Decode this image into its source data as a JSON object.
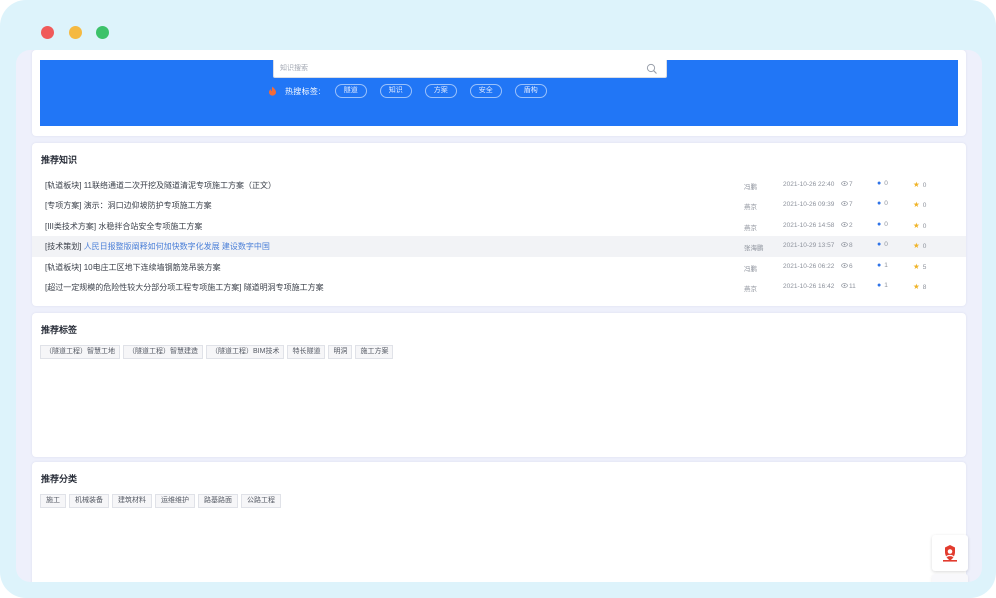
{
  "window": {
    "controls": [
      "close-dot",
      "minimize-dot",
      "maximize-dot"
    ],
    "colors": {
      "close": "#f05a5a",
      "minimize": "#f5b941",
      "maximize": "#3cc26a"
    }
  },
  "hero": {
    "background": "#2176f6",
    "search": {
      "placeholder": "知识搜索",
      "icon": "search-icon"
    },
    "hot": {
      "label": "热搜标签:",
      "icon": "fire-icon",
      "tags": [
        "隧道",
        "知识",
        "方案",
        "安全",
        "盾构"
      ]
    }
  },
  "knowledge": {
    "title": "推荐知识",
    "items": [
      {
        "category": "[轨道板块]",
        "title": "11联络通道二次开挖及隧道清泥专项施工方案（正文）",
        "author": "冯鹏",
        "date": "2021-10-26 22:40",
        "views": "7",
        "comments": "0",
        "stars": "0"
      },
      {
        "category": "[专项方案]",
        "title": "演示：洞口边仰坡防护专项施工方案",
        "author": "燕京",
        "date": "2021-10-26 09:39",
        "views": "7",
        "comments": "0",
        "stars": "0"
      },
      {
        "category": "[III类技术方案]",
        "title": "水稳拌合站安全专项施工方案",
        "author": "燕京",
        "date": "2021-10-26 14:58",
        "views": "2",
        "comments": "0",
        "stars": "0"
      },
      {
        "category": "[技术策划]",
        "title": "人民日报整版阐释如何加快数字化发展 建设数字中国",
        "author": "张海鹏",
        "date": "2021-10-29 13:57",
        "views": "8",
        "comments": "0",
        "stars": "0",
        "highlight": true
      },
      {
        "category": "[轨道板块]",
        "title": "10电庄工区地下连续墙钢筋笼吊装方案",
        "author": "冯鹏",
        "date": "2021-10-26 06:22",
        "views": "6",
        "comments": "1",
        "stars": "5"
      },
      {
        "category": "[超过一定规模的危险性较大分部分项工程专项施工方案]",
        "title": "隧道明洞专项施工方案",
        "author": "燕京",
        "date": "2021-10-26 16:42",
        "views": "11",
        "comments": "1",
        "stars": "8"
      }
    ]
  },
  "tags": {
    "title": "推荐标签",
    "items": [
      "（隧道工程）智慧工地",
      "（隧道工程）智慧建造",
      "（隧道工程）BIM技术",
      "特长隧道",
      "明洞",
      "施工方案"
    ]
  },
  "categories": {
    "title": "推荐分类",
    "items": [
      "施工",
      "机械装备",
      "建筑材料",
      "运维维护",
      "路基路面",
      "公路工程"
    ]
  },
  "float_button": {
    "icon": "service-icon",
    "color": "#e23b2e"
  }
}
